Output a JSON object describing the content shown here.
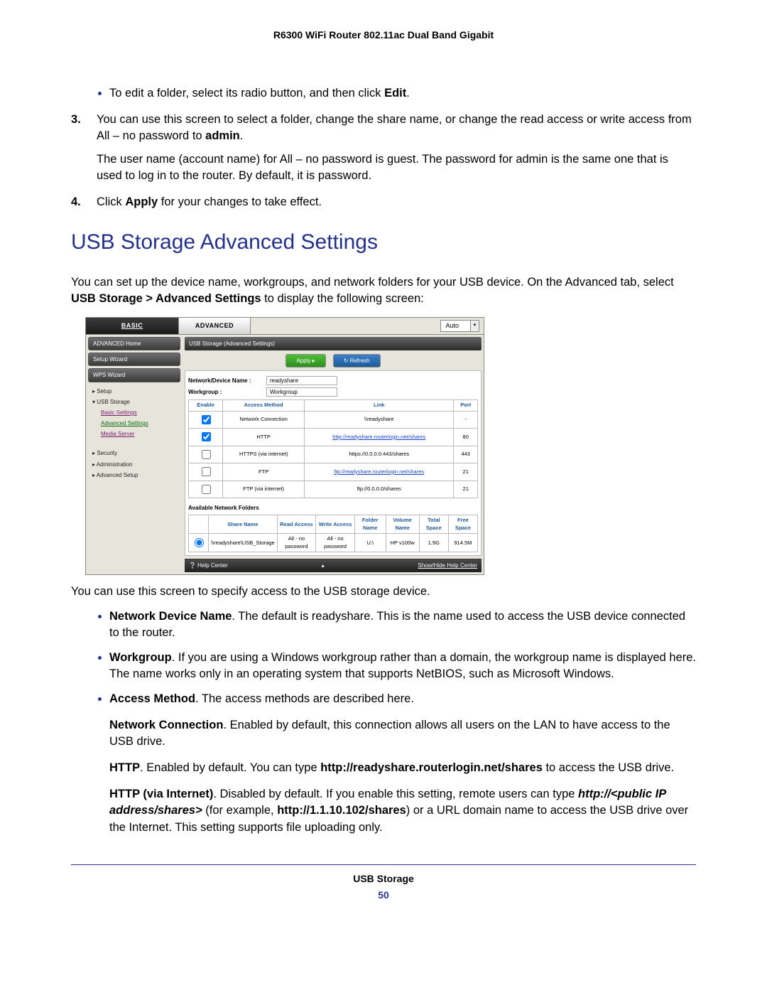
{
  "head": {
    "running": "R6300 WiFi Router 802.11ac Dual Band Gigabit"
  },
  "steps": {
    "bullet_edit": "To edit a folder, select its radio button, and then click ",
    "bullet_edit_bold": "Edit",
    "n3_num": "3.",
    "n3_a": "You can use this screen to select a folder, change the share name, or change the read access or write access from All – no password to ",
    "n3_a_bold": "admin",
    "n3_b": "The user name (account name) for All – no password is guest. The password for admin is the same one that is used to log in to the router. By default, it is password.",
    "n4_num": "4.",
    "n4_a": "Click ",
    "n4_bold": "Apply",
    "n4_b": " for your changes to take effect."
  },
  "section_title": "USB Storage Advanced Settings",
  "intro_a": "You can set up the device name, workgroups, and network folders for your USB device. On the Advanced tab, select ",
  "intro_bold": "USB Storage > Advanced Settings",
  "intro_b": " to display the following screen:",
  "shot": {
    "tabs": {
      "basic": "BASIC",
      "advanced": "ADVANCED",
      "auto": "Auto"
    },
    "side": {
      "home": "ADVANCED Home",
      "setupwiz": "Setup Wizard",
      "wpswiz": "WPS Wizard",
      "setup": "▸ Setup",
      "usb": "▾ USB Storage",
      "basic_settings": "Basic Settings",
      "adv_settings": "Advanced Settings",
      "media": "Media Server",
      "security": "▸ Security",
      "admin": "▸ Administration",
      "advsetup": "▸ Advanced Setup"
    },
    "banner": "USB Storage (Advanced Settings)",
    "apply": "Apply ▸",
    "refresh": "↻ Refresh",
    "devname_l": "Network/Device Name :",
    "devname_v": "readyshare",
    "workgroup_l": "Workgroup :",
    "workgroup_v": "Workgroup",
    "tbl": {
      "h_enable": "Enable",
      "h_method": "Access Method",
      "h_link": "Link",
      "h_port": "Port",
      "rows": [
        {
          "checked": true,
          "method": "Network Connection",
          "link_text": "\\\\readyshare",
          "is_link": false,
          "port": "-"
        },
        {
          "checked": true,
          "method": "HTTP",
          "link_text": "http://readyshare.routerlogin.net/shares",
          "is_link": true,
          "port": "80"
        },
        {
          "checked": false,
          "method": "HTTPS (via internet)",
          "link_text": "https://0.0.0.0:443/shares",
          "is_link": false,
          "port": "443"
        },
        {
          "checked": false,
          "method": "FTP",
          "link_text": "ftp://readyshare.routerlogin.net/shares",
          "is_link": true,
          "port": "21"
        },
        {
          "checked": false,
          "method": "FTP (via internet)",
          "link_text": "ftp://0.0.0.0/shares",
          "is_link": false,
          "port": "21"
        }
      ]
    },
    "folders_cap": "Available Network Folders",
    "ftbl": {
      "h_share": "Share Name",
      "h_read": "Read Access",
      "h_write": "Write Access",
      "h_folder": "Folder Name",
      "h_vol": "Volume Name",
      "h_total": "Total Space",
      "h_free": "Free Space",
      "row": {
        "share": "\\\\readyshare\\USB_Storage",
        "read": "All - no password",
        "write": "All - no password",
        "folder": "U:\\",
        "vol": "HP v100w",
        "total": "1.9G",
        "free": "914.5M"
      }
    },
    "help_left": "❔ Help Center",
    "help_right": "Show/Hide Help Center"
  },
  "after_shot": "You can use this screen to specify access to the USB storage device.",
  "defs": {
    "d1_b": "Network Device Name",
    "d1": ". The default is readyshare. This is the name used to access the USB device connected to the router.",
    "d2_b": "Workgroup",
    "d2": ". If you are using a Windows workgroup rather than a domain, the workgroup name is displayed here. The name works only in an operating system that supports NetBIOS, such as Microsoft Windows.",
    "d3_b": "Access Method",
    "d3": ". The access methods are described here.",
    "m1_b": "Network Connection",
    "m1": ". Enabled by default, this connection allows all users on the LAN to have access to the USB drive.",
    "m2_b1": "HTTP",
    "m2_a": ". Enabled by default. You can type ",
    "m2_b2": "http://readyshare.routerlogin.net/shares",
    "m2_c": " to access the USB drive.",
    "m3_b1": "HTTP (via Internet)",
    "m3_a": ". Disabled by default. If you enable this setting, remote users can type ",
    "m3_b2": "http://<public IP address/shares>",
    "m3_b2_mid": " (for example, ",
    "m3_b3": "http://1.1.10.102/shares",
    "m3_c": ") or a URL domain name to access the USB drive over the Internet. This setting supports file uploading only."
  },
  "footer": {
    "label": "USB Storage",
    "page": "50"
  }
}
